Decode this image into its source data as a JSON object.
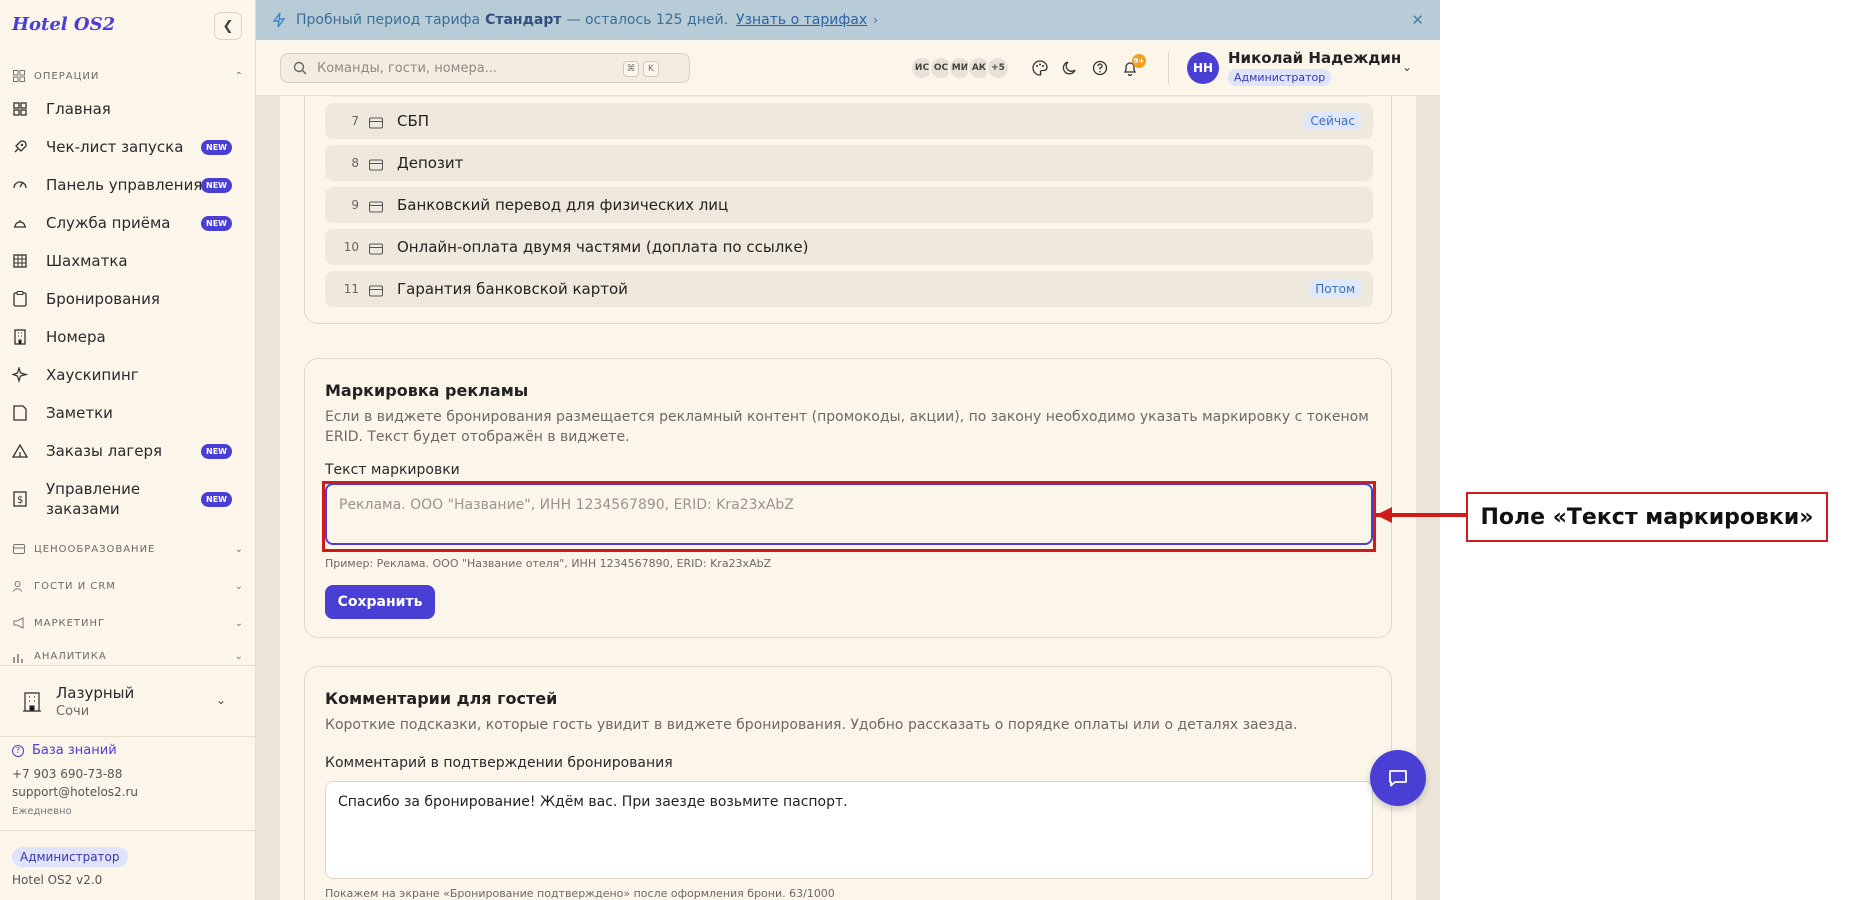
{
  "app": {
    "title": "Hotel OS2"
  },
  "sidebar": {
    "sections": [
      {
        "label": "ОПЕРАЦИИ",
        "icon": "grid-icon"
      },
      {
        "label": "ЦЕНООБРАЗОВАНИЕ",
        "icon": "wallet-icon"
      },
      {
        "label": "ГОСТИ И CRM",
        "icon": "users-icon"
      },
      {
        "label": "МАРКЕТИНГ",
        "icon": "megaphone-icon"
      },
      {
        "label": "АНАЛИТИКА",
        "icon": "chart-icon"
      }
    ],
    "items": [
      {
        "label": "Главная",
        "icon": "grid-icon"
      },
      {
        "label": "Чек-лист запуска",
        "icon": "rocket-icon",
        "badge": "NEW"
      },
      {
        "label": "Панель управления",
        "icon": "gauge-icon",
        "badge": "NEW"
      },
      {
        "label": "Служба приёма",
        "icon": "bell-desk-icon",
        "badge": "NEW"
      },
      {
        "label": "Шахматка",
        "icon": "table-icon"
      },
      {
        "label": "Бронирования",
        "icon": "clipboard-icon"
      },
      {
        "label": "Номера",
        "icon": "building-icon"
      },
      {
        "label": "Хаускипинг",
        "icon": "sparkle-icon"
      },
      {
        "label": "Заметки",
        "icon": "note-icon"
      },
      {
        "label": "Заказы лагеря",
        "icon": "tent-icon",
        "badge": "NEW"
      },
      {
        "label": "Управление заказами",
        "icon": "receipt-icon",
        "badge": "NEW"
      }
    ],
    "hotel": {
      "name": "Лазурный",
      "city": "Сочи"
    },
    "knowledge_base": "База знаний",
    "phone": "+7 903 690-73-88",
    "email": "support@hotelos2.ru",
    "schedule": "Ежедневно",
    "role": "Администратор",
    "version": "Hotel OS2 v2.0"
  },
  "banner": {
    "text_before": "Пробный период тарифа",
    "plan": "Стандарт",
    "text_after": "— осталось 125 дней.",
    "link": "Узнать о тарифах"
  },
  "header": {
    "search_placeholder": "Команды, гости, номера...",
    "kbd1": "⌘",
    "kbd2": "K",
    "avatars": [
      "ИС",
      "ОС",
      "МИ",
      "АК"
    ],
    "more": "+5",
    "notif_count": "9+",
    "user": {
      "initials": "НН",
      "name": "Николай Надеждин",
      "role": "Администратор"
    }
  },
  "payments": [
    {
      "num": "7",
      "label": "СБП",
      "tag": "Сейчас"
    },
    {
      "num": "8",
      "label": "Депозит"
    },
    {
      "num": "9",
      "label": "Банковский перевод для физических лиц"
    },
    {
      "num": "10",
      "label": "Онлайн-оплата двумя частями (доплата по ссылке)"
    },
    {
      "num": "11",
      "label": "Гарантия банковской картой",
      "tag": "Потом"
    }
  ],
  "ad_marking": {
    "title": "Маркировка рекламы",
    "desc": "Если в виджете бронирования размещается рекламный контент (промокоды, акции), по закону необходимо указать маркировку с токеном ERID. Текст будет отображён в виджете.",
    "field_label": "Текст маркировки",
    "placeholder": "Реклама. ООО \"Название\", ИНН 1234567890, ERID: Kra23xAbZ",
    "hint": "Пример: Реклама. ООО \"Название отеля\", ИНН 1234567890, ERID: Kra23xAbZ",
    "save": "Сохранить"
  },
  "comments": {
    "title": "Комментарии для гостей",
    "desc": "Короткие подсказки, которые гость увидит в виджете бронирования. Удобно рассказать о порядке оплаты или о деталях заезда.",
    "field_label": "Комментарий в подтверждении бронирования",
    "value": "Спасибо за бронирование! Ждём вас. При заезде возьмите паспорт.",
    "hint": "Покажем на экране «Бронирование подтверждено» после оформления брони. 63/1000"
  },
  "annotation": {
    "callout": "Поле «Текст маркировки»"
  },
  "colors": {
    "accent": "#4a3fd4",
    "annotation": "#d11a1a",
    "sidebar_bg": "#fbf5ea"
  }
}
